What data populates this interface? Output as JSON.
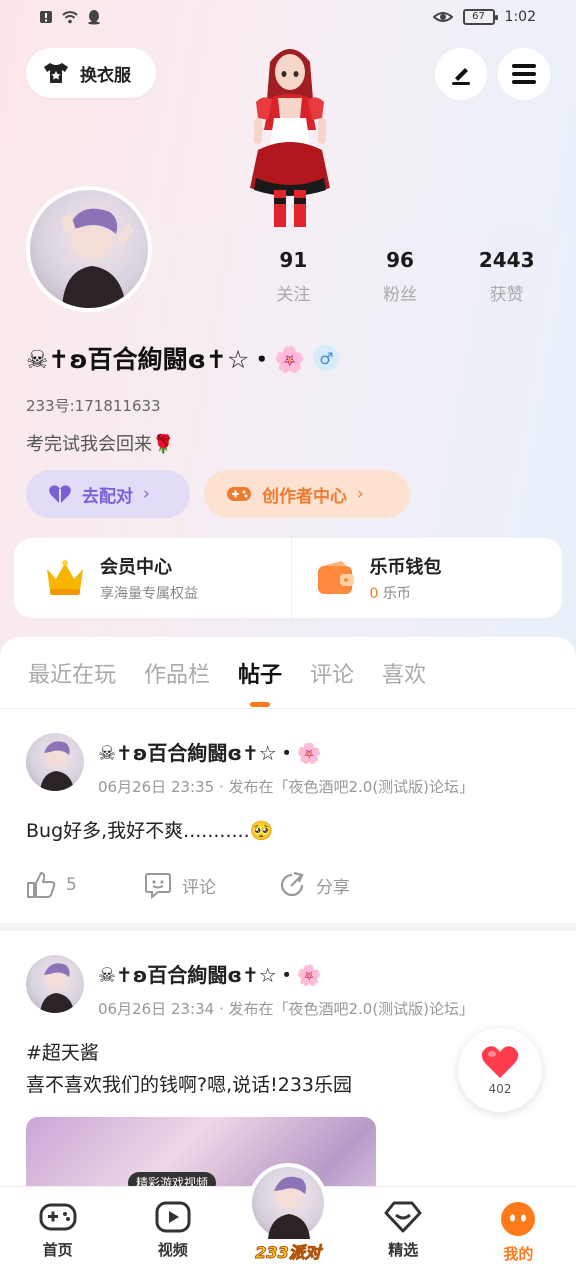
{
  "status_bar": {
    "time": "1:02",
    "battery": "67"
  },
  "header": {
    "outfit_label": "换衣服"
  },
  "profile": {
    "stats": [
      {
        "num": "91",
        "label": "关注"
      },
      {
        "num": "96",
        "label": "粉丝"
      },
      {
        "num": "2443",
        "label": "获赞"
      }
    ],
    "nickname": "☠✝ʚ百合絢闘ɞ✝☆・🌸",
    "gender_symbol": "♂",
    "uid": "233号:171811633",
    "bio": "考完试我会回来🌹",
    "match_label": "去配对",
    "creator_label": "创作者中心"
  },
  "vip": {
    "title": "会员中心",
    "subtitle": "享海量专属权益"
  },
  "wallet": {
    "title": "乐币钱包",
    "amount": "0",
    "unit": "乐币"
  },
  "tabs": [
    {
      "label": "最近在玩"
    },
    {
      "label": "作品栏"
    },
    {
      "label": "帖子"
    },
    {
      "label": "评论"
    },
    {
      "label": "喜欢"
    }
  ],
  "posts": [
    {
      "author": "☠✝ʚ百合絢闘ɞ✝☆・🌸",
      "meta": "06月26日 23:35 · 发布在「夜色酒吧2.0(测试版)论坛」",
      "text": "Bug好多,我好不爽...........🥺",
      "like_count": "5",
      "comment_label": "评论",
      "share_label": "分享"
    },
    {
      "author": "☠✝ʚ百合絢闘ɞ✝☆・🌸",
      "meta": "06月26日 23:34 · 发布在「夜色酒吧2.0(测试版)论坛」",
      "text": "#超天酱\n喜不喜欢我们的钱啊?嗯,说话!233乐园"
    }
  ],
  "floating_like": {
    "count": "402"
  },
  "bottom_nav": {
    "video_tip": "精彩游戏视频",
    "items": [
      {
        "label": "首页"
      },
      {
        "label": "视频"
      },
      {
        "label": "233派对"
      },
      {
        "label": "精选"
      },
      {
        "label": "我的"
      }
    ]
  }
}
